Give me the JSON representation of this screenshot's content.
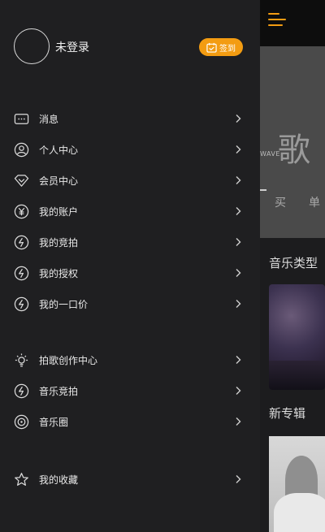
{
  "drawer": {
    "user": {
      "login_label": "未登录",
      "checkin_label": "签到"
    },
    "menu_group1": [
      {
        "label": "消息",
        "icon": "message-icon"
      },
      {
        "label": "个人中心",
        "icon": "user-icon"
      },
      {
        "label": "会员中心",
        "icon": "diamond-icon"
      },
      {
        "label": "我的账户",
        "icon": "yen-icon"
      },
      {
        "label": "我的竞拍",
        "icon": "lightning-icon"
      },
      {
        "label": "我的授权",
        "icon": "lightning-icon"
      },
      {
        "label": "我的一口价",
        "icon": "lightning-icon"
      }
    ],
    "menu_group2": [
      {
        "label": "拍歌创作中心",
        "icon": "bulb-icon"
      },
      {
        "label": "音乐竞拍",
        "icon": "lightning-icon"
      },
      {
        "label": "音乐圈",
        "icon": "disc-icon"
      }
    ],
    "menu_group3": [
      {
        "label": "我的收藏",
        "icon": "star-icon"
      }
    ]
  },
  "main": {
    "banner": {
      "title_char": "歌",
      "wave_text": "WAVE",
      "sub1": "买",
      "sub2": "单"
    },
    "section_music_type": "音乐类型",
    "section_new_album": "新专辑"
  },
  "colors": {
    "accent": "#f39c12",
    "drawer_bg": "#1f1f21",
    "text": "#eaeaea"
  }
}
